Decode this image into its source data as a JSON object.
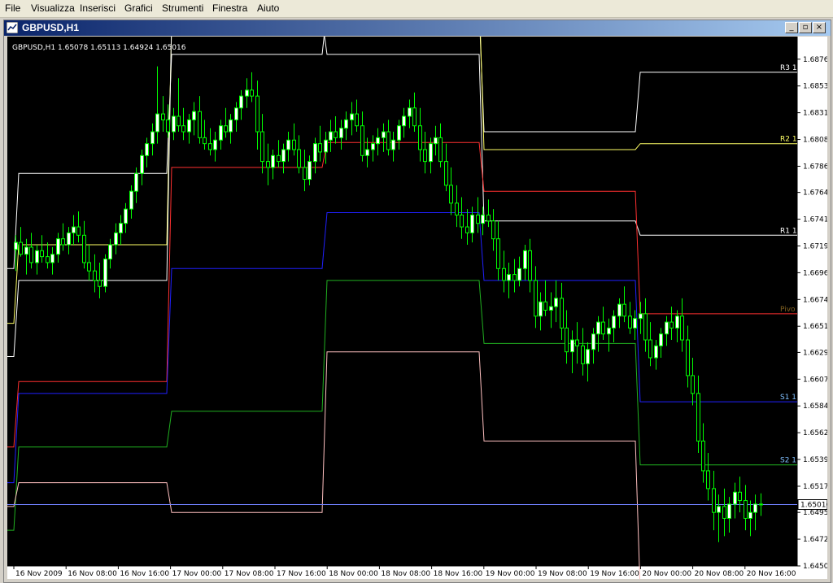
{
  "menu": [
    "File",
    "Visualizza",
    "Inserisci",
    "Grafici",
    "Strumenti",
    "Finestra",
    "Aiuto"
  ],
  "window": {
    "title": "GBPUSD,H1"
  },
  "chart_header": "GBPUSD,H1  1.65078 1.65113 1.64924 1.65016",
  "current_price_label": "1.65016",
  "colors": {
    "background": "#000000",
    "candle": "#00ff00",
    "bull_body": "#ffffff",
    "bear_body": "#000000",
    "R3": "#ffffff",
    "R2": "#ffff66",
    "R1": "#ffffff",
    "pivot": "#ff3030",
    "S1": "#2020ff",
    "S2": "#20b020",
    "S3": "#ffc0c0",
    "mid": "#80ffff",
    "bid_line": "#7080ff"
  },
  "chart_data": {
    "type": "candlestick",
    "symbol": "GBPUSD",
    "timeframe": "H1",
    "ohlc_last": {
      "open": 1.65078,
      "high": 1.65113,
      "low": 1.64924,
      "close": 1.65016
    },
    "ylim": [
      1.645,
      1.6895
    ],
    "y_ticks": [
      "1.68760",
      "1.68535",
      "1.68310",
      "1.68085",
      "1.67860",
      "1.67640",
      "1.67415",
      "1.67190",
      "1.66965",
      "1.66740",
      "1.66515",
      "1.66295",
      "1.66070",
      "1.65845",
      "1.65620",
      "1.65395",
      "1.65170",
      "1.64950",
      "1.64725",
      "1.64500"
    ],
    "x_ticks": [
      "16 Nov 2009",
      "16 Nov 08:00",
      "16 Nov 16:00",
      "17 Nov 00:00",
      "17 Nov 08:00",
      "17 Nov 16:00",
      "18 Nov 00:00",
      "18 Nov 08:00",
      "18 Nov 16:00",
      "19 Nov 00:00",
      "19 Nov 08:00",
      "19 Nov 16:00",
      "20 Nov 00:00",
      "20 Nov 08:00",
      "20 Nov 16:00"
    ],
    "level_labels": [
      "R3 1",
      "R2 1",
      "R1 1",
      "Pivo",
      "S1 1",
      "S2 1"
    ],
    "pivot_levels": {
      "R3": [
        1.67,
        1.678,
        1.688,
        1.6918,
        1.6815,
        1.6865
      ],
      "R2": [
        1.6654,
        1.672,
        1.6905,
        1.6932,
        1.68,
        1.6805
      ],
      "R1": [
        1.6626,
        1.669,
        1.691,
        1.688,
        1.674,
        1.6728
      ],
      "P": [
        1.655,
        1.6605,
        1.6785,
        1.6806,
        1.6765,
        1.6662
      ],
      "S1": [
        1.652,
        1.6595,
        1.67,
        1.6747,
        1.669,
        1.6588
      ],
      "S2": [
        1.648,
        1.655,
        1.658,
        1.669,
        1.6637,
        1.6535
      ],
      "S3": [
        1.65,
        1.652,
        1.6495,
        1.663,
        1.6555,
        1.6428
      ]
    },
    "candles": [
      [
        1.6716,
        1.6728,
        1.6698,
        1.6722
      ],
      [
        1.6722,
        1.6735,
        1.671,
        1.6712
      ],
      [
        1.6712,
        1.6725,
        1.6695,
        1.6718
      ],
      [
        1.6718,
        1.673,
        1.67,
        1.6705
      ],
      [
        1.6705,
        1.672,
        1.6695,
        1.6715
      ],
      [
        1.6715,
        1.6728,
        1.6705,
        1.671
      ],
      [
        1.671,
        1.6722,
        1.67,
        1.6705
      ],
      [
        1.6705,
        1.6718,
        1.6695,
        1.6712
      ],
      [
        1.6712,
        1.673,
        1.6705,
        1.6725
      ],
      [
        1.6725,
        1.6738,
        1.6715,
        1.672
      ],
      [
        1.672,
        1.6735,
        1.6712,
        1.673
      ],
      [
        1.673,
        1.6745,
        1.672,
        1.6735
      ],
      [
        1.6735,
        1.6748,
        1.6722,
        1.6728
      ],
      [
        1.6728,
        1.674,
        1.67,
        1.6705
      ],
      [
        1.6705,
        1.672,
        1.669,
        1.6698
      ],
      [
        1.6698,
        1.6712,
        1.668,
        1.669
      ],
      [
        1.669,
        1.6705,
        1.6675,
        1.6685
      ],
      [
        1.6685,
        1.6712,
        1.668,
        1.6708
      ],
      [
        1.6708,
        1.6725,
        1.67,
        1.672
      ],
      [
        1.672,
        1.6738,
        1.6712,
        1.673
      ],
      [
        1.673,
        1.6745,
        1.672,
        1.6738
      ],
      [
        1.6738,
        1.6755,
        1.673,
        1.675
      ],
      [
        1.675,
        1.677,
        1.6742,
        1.6765
      ],
      [
        1.6765,
        1.6785,
        1.6755,
        1.678
      ],
      [
        1.678,
        1.68,
        1.677,
        1.6795
      ],
      [
        1.6795,
        1.681,
        1.6785,
        1.6805
      ],
      [
        1.6805,
        1.6822,
        1.6795,
        1.6815
      ],
      [
        1.6815,
        1.687,
        1.6805,
        1.683
      ],
      [
        1.683,
        1.6845,
        1.6815,
        1.6825
      ],
      [
        1.6825,
        1.6838,
        1.681,
        1.6815
      ],
      [
        1.6815,
        1.6835,
        1.6808,
        1.6828
      ],
      [
        1.6828,
        1.686,
        1.6815,
        1.682
      ],
      [
        1.682,
        1.6835,
        1.6808,
        1.6815
      ],
      [
        1.6815,
        1.683,
        1.6805,
        1.6825
      ],
      [
        1.6825,
        1.684,
        1.6812,
        1.6832
      ],
      [
        1.6832,
        1.6845,
        1.6805,
        1.681
      ],
      [
        1.681,
        1.6825,
        1.68,
        1.6805
      ],
      [
        1.6805,
        1.6818,
        1.6795,
        1.68
      ],
      [
        1.68,
        1.6815,
        1.679,
        1.6808
      ],
      [
        1.6808,
        1.6825,
        1.68,
        1.682
      ],
      [
        1.682,
        1.6835,
        1.681,
        1.6815
      ],
      [
        1.6815,
        1.683,
        1.6805,
        1.6825
      ],
      [
        1.6825,
        1.684,
        1.6815,
        1.6835
      ],
      [
        1.6835,
        1.685,
        1.6825,
        1.6845
      ],
      [
        1.6845,
        1.686,
        1.6835,
        1.685
      ],
      [
        1.685,
        1.6865,
        1.684,
        1.6845
      ],
      [
        1.6845,
        1.6858,
        1.68,
        1.6815
      ],
      [
        1.6815,
        1.683,
        1.678,
        1.679
      ],
      [
        1.679,
        1.6805,
        1.677,
        1.6785
      ],
      [
        1.6785,
        1.68,
        1.6775,
        1.6795
      ],
      [
        1.6795,
        1.6808,
        1.6785,
        1.679
      ],
      [
        1.679,
        1.6805,
        1.678,
        1.68
      ],
      [
        1.68,
        1.6815,
        1.679,
        1.6808
      ],
      [
        1.6808,
        1.6822,
        1.6795,
        1.68
      ],
      [
        1.68,
        1.6812,
        1.678,
        1.6785
      ],
      [
        1.6785,
        1.68,
        1.6765,
        1.6775
      ],
      [
        1.6775,
        1.6795,
        1.677,
        1.679
      ],
      [
        1.679,
        1.681,
        1.678,
        1.6805
      ],
      [
        1.6805,
        1.682,
        1.679,
        1.6798
      ],
      [
        1.6798,
        1.6815,
        1.6788,
        1.6808
      ],
      [
        1.6808,
        1.6825,
        1.6798,
        1.6815
      ],
      [
        1.6815,
        1.6828,
        1.6805,
        1.681
      ],
      [
        1.681,
        1.6825,
        1.68,
        1.6818
      ],
      [
        1.6818,
        1.6832,
        1.6808,
        1.6825
      ],
      [
        1.6825,
        1.684,
        1.6812,
        1.683
      ],
      [
        1.683,
        1.6842,
        1.6815,
        1.682
      ],
      [
        1.682,
        1.6832,
        1.679,
        1.6795
      ],
      [
        1.6795,
        1.681,
        1.6785,
        1.68
      ],
      [
        1.68,
        1.6812,
        1.679,
        1.6805
      ],
      [
        1.6805,
        1.6818,
        1.6795,
        1.681
      ],
      [
        1.681,
        1.6822,
        1.6798,
        1.6815
      ],
      [
        1.6815,
        1.6825,
        1.6795,
        1.68
      ],
      [
        1.68,
        1.6815,
        1.679,
        1.6808
      ],
      [
        1.6808,
        1.6825,
        1.68,
        1.682
      ],
      [
        1.682,
        1.6835,
        1.681,
        1.6828
      ],
      [
        1.6828,
        1.6842,
        1.6818,
        1.6835
      ],
      [
        1.6835,
        1.6848,
        1.6815,
        1.682
      ],
      [
        1.682,
        1.6835,
        1.679,
        1.68
      ],
      [
        1.68,
        1.6815,
        1.678,
        1.679
      ],
      [
        1.679,
        1.681,
        1.678,
        1.6805
      ],
      [
        1.6805,
        1.682,
        1.6795,
        1.681
      ],
      [
        1.681,
        1.6822,
        1.6785,
        1.679
      ],
      [
        1.679,
        1.6805,
        1.6765,
        1.677
      ],
      [
        1.677,
        1.6785,
        1.6745,
        1.6755
      ],
      [
        1.6755,
        1.677,
        1.6735,
        1.6745
      ],
      [
        1.6745,
        1.676,
        1.6725,
        1.6735
      ],
      [
        1.6735,
        1.675,
        1.672,
        1.673
      ],
      [
        1.673,
        1.6752,
        1.6722,
        1.6745
      ],
      [
        1.6745,
        1.676,
        1.673,
        1.6738
      ],
      [
        1.6738,
        1.6752,
        1.6728,
        1.6745
      ],
      [
        1.6745,
        1.6758,
        1.6735,
        1.674
      ],
      [
        1.674,
        1.675,
        1.6715,
        1.6725
      ],
      [
        1.6725,
        1.674,
        1.669,
        1.67
      ],
      [
        1.67,
        1.6715,
        1.668,
        1.669
      ],
      [
        1.669,
        1.6705,
        1.6675,
        1.6695
      ],
      [
        1.6695,
        1.6708,
        1.668,
        1.669
      ],
      [
        1.669,
        1.671,
        1.6685,
        1.67
      ],
      [
        1.67,
        1.672,
        1.669,
        1.6715
      ],
      [
        1.6715,
        1.6725,
        1.668,
        1.669
      ],
      [
        1.669,
        1.6702,
        1.665,
        1.666
      ],
      [
        1.666,
        1.668,
        1.6648,
        1.6672
      ],
      [
        1.6672,
        1.669,
        1.666,
        1.6665
      ],
      [
        1.6665,
        1.668,
        1.665,
        1.6668
      ],
      [
        1.6668,
        1.669,
        1.6655,
        1.6675
      ],
      [
        1.6675,
        1.6688,
        1.664,
        1.665
      ],
      [
        1.665,
        1.6665,
        1.662,
        1.663
      ],
      [
        1.663,
        1.6648,
        1.6612,
        1.664
      ],
      [
        1.664,
        1.6655,
        1.662,
        1.6635
      ],
      [
        1.6635,
        1.665,
        1.661,
        1.662
      ],
      [
        1.662,
        1.6638,
        1.6605,
        1.6632
      ],
      [
        1.6632,
        1.665,
        1.662,
        1.6645
      ],
      [
        1.6645,
        1.666,
        1.663,
        1.6655
      ],
      [
        1.6655,
        1.6668,
        1.664,
        1.6645
      ],
      [
        1.6645,
        1.6658,
        1.663,
        1.665
      ],
      [
        1.665,
        1.6665,
        1.6638,
        1.666
      ],
      [
        1.666,
        1.6675,
        1.665,
        1.667
      ],
      [
        1.667,
        1.6685,
        1.6655,
        1.666
      ],
      [
        1.666,
        1.6672,
        1.6645,
        1.665
      ],
      [
        1.665,
        1.6665,
        1.664,
        1.6658
      ],
      [
        1.6658,
        1.6672,
        1.6645,
        1.6662
      ],
      [
        1.6662,
        1.6675,
        1.663,
        1.664
      ],
      [
        1.664,
        1.6655,
        1.6618,
        1.6625
      ],
      [
        1.6625,
        1.664,
        1.6615,
        1.6635
      ],
      [
        1.6635,
        1.665,
        1.6625,
        1.6645
      ],
      [
        1.6645,
        1.666,
        1.6635,
        1.6655
      ],
      [
        1.6655,
        1.6668,
        1.664,
        1.665
      ],
      [
        1.665,
        1.6665,
        1.6638,
        1.666
      ],
      [
        1.666,
        1.6675,
        1.663,
        1.664
      ],
      [
        1.664,
        1.6652,
        1.66,
        1.661
      ],
      [
        1.661,
        1.6625,
        1.6585,
        1.6595
      ],
      [
        1.6595,
        1.661,
        1.6545,
        1.6555
      ],
      [
        1.6555,
        1.657,
        1.652,
        1.653
      ],
      [
        1.653,
        1.6545,
        1.6505,
        1.6515
      ],
      [
        1.6515,
        1.653,
        1.648,
        1.6495
      ],
      [
        1.6495,
        1.651,
        1.647,
        1.65
      ],
      [
        1.65,
        1.6515,
        1.6475,
        1.649
      ],
      [
        1.649,
        1.6508,
        1.6478,
        1.6502
      ],
      [
        1.6502,
        1.652,
        1.649,
        1.6512
      ],
      [
        1.6512,
        1.6525,
        1.6495,
        1.6505
      ],
      [
        1.6505,
        1.6518,
        1.648,
        1.649
      ],
      [
        1.649,
        1.6505,
        1.6475,
        1.6495
      ],
      [
        1.6495,
        1.651,
        1.648,
        1.6502
      ],
      [
        1.6502,
        1.6511,
        1.6492,
        1.6502
      ]
    ]
  }
}
